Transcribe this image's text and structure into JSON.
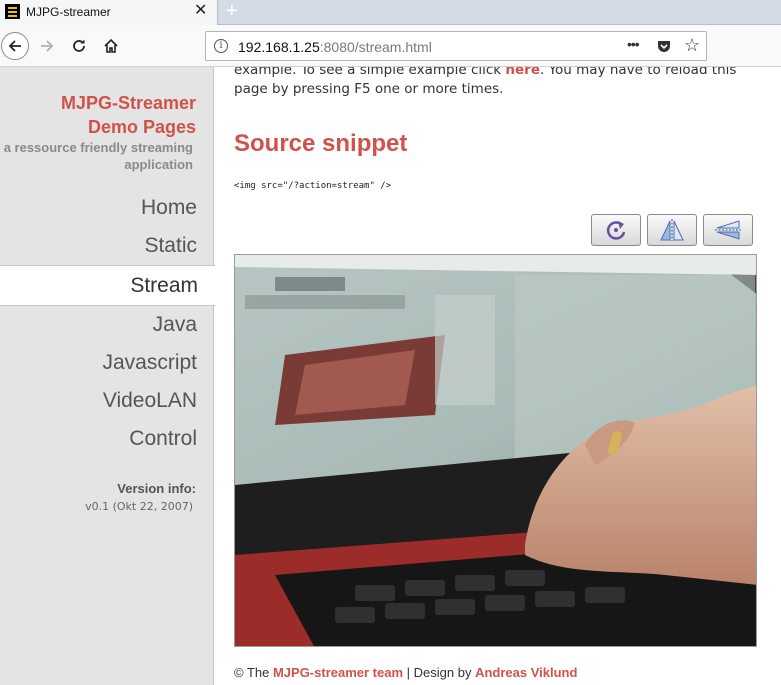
{
  "browser": {
    "tab": {
      "title": "MJPG-streamer",
      "close": "✕"
    },
    "new_tab": "+",
    "url": {
      "host": "192.168.1.25",
      "rest": ":8080/stream.html"
    },
    "page_actions": "•••"
  },
  "sidebar": {
    "title_line1": "MJPG-Streamer",
    "title_line2": "Demo Pages",
    "subtitle": "a ressource friendly streaming application",
    "menu": [
      {
        "label": "Home"
      },
      {
        "label": "Static"
      },
      {
        "label": "Stream"
      },
      {
        "label": "Java"
      },
      {
        "label": "Javascript"
      },
      {
        "label": "VideoLAN"
      },
      {
        "label": "Control"
      }
    ],
    "active_item": "Stream",
    "version_label": "Version info:",
    "version_value": "v0.1 (Okt 22, 2007)"
  },
  "content": {
    "intro_before": "example. To see a simple example click ",
    "intro_link": "here",
    "intro_after": ". You may have to reload this page by pressing F5 one or more times.",
    "section_title": "Source snippet",
    "snippet": "<img src=\"/?action=stream\" />",
    "toolbar": {
      "buttons": [
        {
          "icon": "rotate-icon"
        },
        {
          "icon": "flip-vertical-icon"
        },
        {
          "icon": "flip-horizontal-icon"
        }
      ]
    }
  },
  "footer": {
    "prefix": "© The ",
    "team_link": "MJPG-streamer team",
    "middle": " | Design by ",
    "designer_link": "Andreas Viklund"
  },
  "colors": {
    "accent": "#d0524b",
    "sidebar_bg": "#e4e4e4",
    "text": "#333333"
  }
}
